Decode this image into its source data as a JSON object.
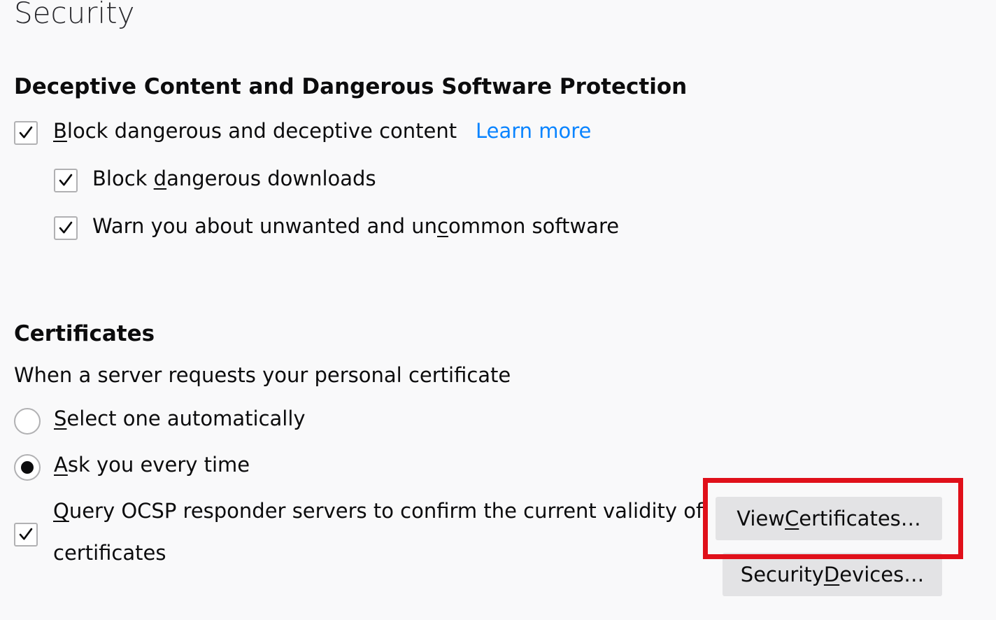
{
  "page": {
    "title": "Security"
  },
  "deceptive": {
    "heading": "Deceptive Content and Dangerous Software Protection",
    "block_content": {
      "label_pre": "",
      "label_key": "B",
      "label_post": "lock dangerous and deceptive content",
      "checked": true
    },
    "learn_more": "Learn more",
    "block_downloads": {
      "label_pre": "Block ",
      "label_key": "d",
      "label_post": "angerous downloads",
      "checked": true
    },
    "warn_software": {
      "label_pre": "Warn you about unwanted and un",
      "label_key": "c",
      "label_post": "ommon software",
      "checked": true
    }
  },
  "certificates": {
    "heading": "Certificates",
    "description": "When a server requests your personal certificate",
    "radio_auto": {
      "label_key": "S",
      "label_post": "elect one automatically",
      "selected": false
    },
    "radio_ask": {
      "label_key": "A",
      "label_post": "sk you every time",
      "selected": true
    },
    "ocsp": {
      "label_key": "Q",
      "label_line1_post": "uery OCSP responder servers to confirm the current validity of",
      "label_line2": "certificates",
      "checked": true
    },
    "view_button": {
      "label_pre": "View ",
      "label_key": "C",
      "label_post": "ertificates…"
    },
    "devices_button": {
      "label_pre": "Security ",
      "label_key": "D",
      "label_post": "evices…"
    }
  },
  "colors": {
    "background": "#f9f9fa",
    "link": "#0a84ff",
    "highlight": "#e0101a",
    "button": "#e3e3e5"
  }
}
